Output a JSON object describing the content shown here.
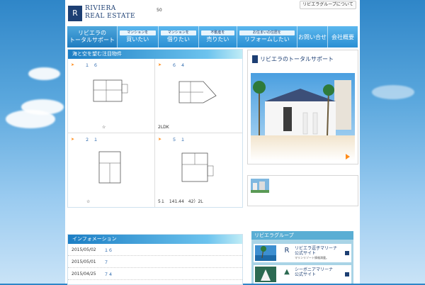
{
  "header": {
    "logo_mark": "R",
    "logo_line1": "RIVIERA",
    "logo_line2": "REAL ESTATE",
    "number": "50",
    "group_link": "リビエラグループについて"
  },
  "nav": {
    "items": [
      {
        "small": "",
        "big": "リビエラの\nトータルサポート"
      },
      {
        "small": "マンションを",
        "big": "買いたい"
      },
      {
        "small": "マンションを",
        "big": "借りたい"
      },
      {
        "small": "不動産を",
        "big": "売りたい"
      },
      {
        "small": "お住まいの住居を",
        "big": "リフォームしたい"
      },
      {
        "small": "",
        "big": "お問い合せ"
      },
      {
        "small": "",
        "big": "会社概要"
      }
    ]
  },
  "featured": {
    "heading": "海と空を望む注目物件",
    "items": [
      {
        "title": "１６",
        "caption": "☆"
      },
      {
        "title": "６４",
        "caption": "2LDK"
      },
      {
        "title": "２１",
        "caption": "☆"
      },
      {
        "title": "５１",
        "caption": "5１　141.44　42）2L"
      }
    ]
  },
  "info": {
    "heading": "インフォメーション",
    "rows": [
      {
        "date": "2015/05/02",
        "text": "１６"
      },
      {
        "date": "2015/05/01",
        "text": "７"
      },
      {
        "date": "2015/04/25",
        "text": "７４"
      }
    ]
  },
  "side": {
    "title": "リビエラのトータルサポート"
  },
  "group": {
    "heading": "リビエラグループ",
    "banners": [
      {
        "logo": "R",
        "line1": "リビエラ逗子マリーナ",
        "line2": "公式サイト",
        "sub": "マリンリゾート情報満載。"
      },
      {
        "logo": "▲",
        "line1": "シーボニアマリーナ",
        "line2": "公式サイト",
        "sub": ""
      }
    ]
  },
  "colors": {
    "brand": "#1d3f73",
    "accent": "#ff8c1a",
    "nav_blue": "#2a8fd3"
  }
}
